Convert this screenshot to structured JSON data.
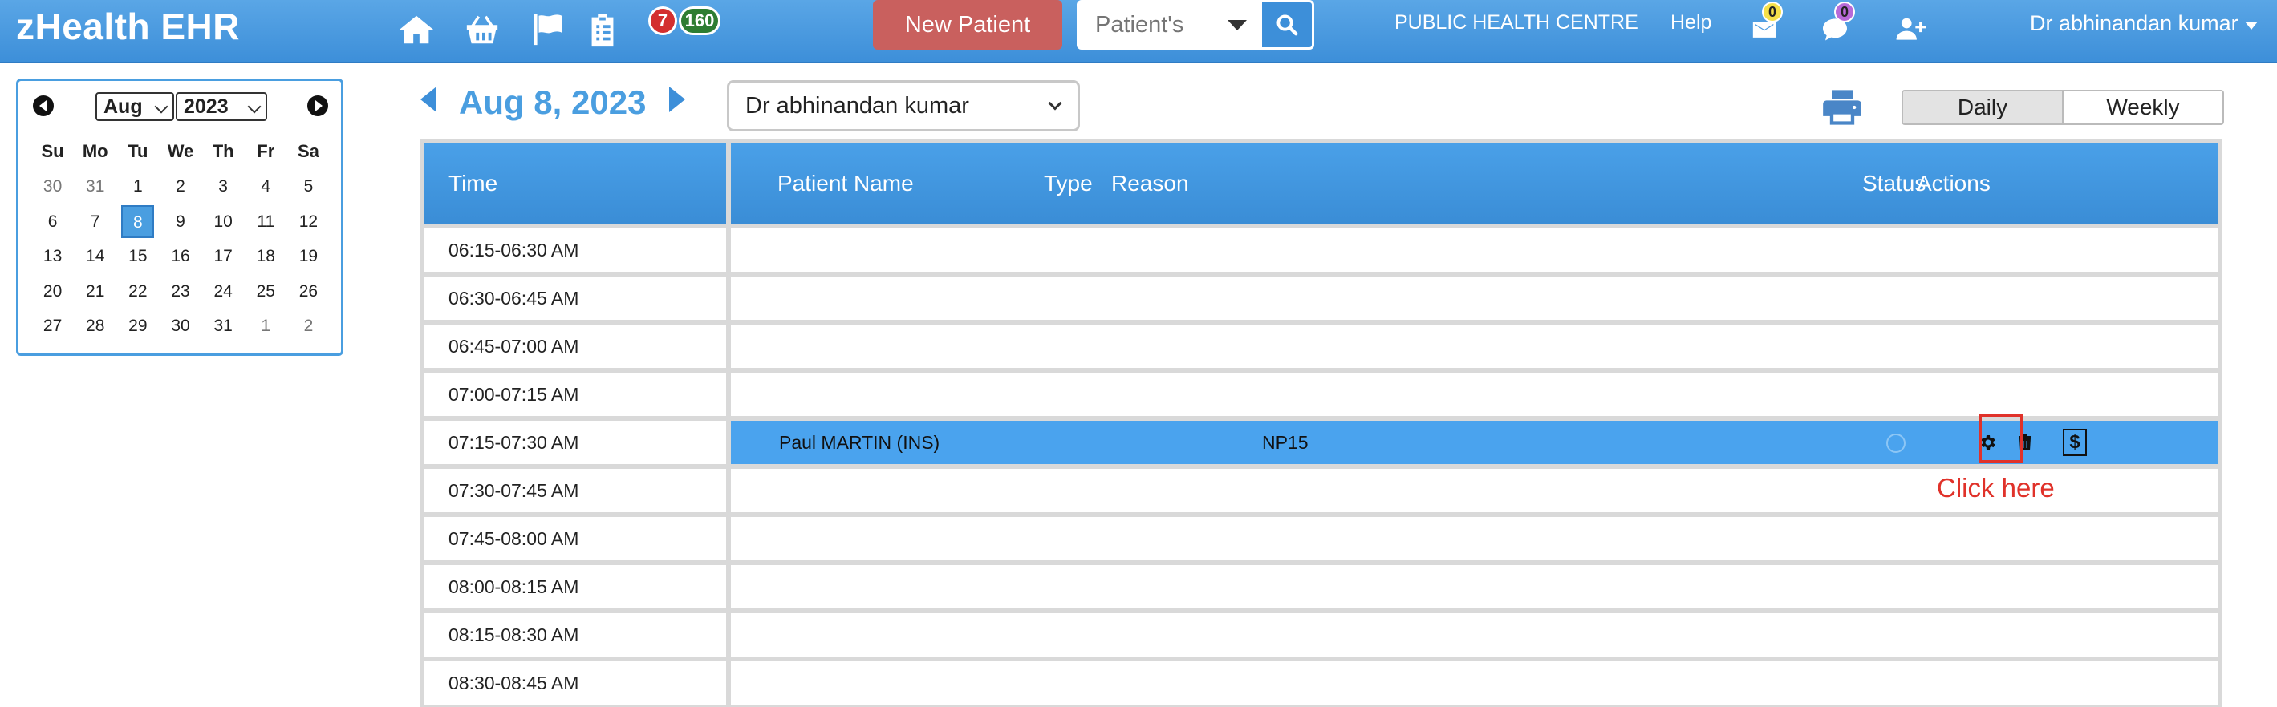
{
  "app": {
    "brand": "zHealth EHR",
    "badges": {
      "red": "7",
      "green": "160"
    },
    "new_patient_label": "New Patient",
    "search_placeholder": "Patient's",
    "facility": "PUBLIC HEALTH CENTRE",
    "help": "Help",
    "mail_count": "0",
    "chat_count": "0",
    "user": "Dr abhinandan kumar",
    "colors": {
      "topbar": "#3d8fd9",
      "new_patient": "#c9605e",
      "accent": "#4a9ee0",
      "annotation": "#e0322a"
    },
    "icons": [
      "home-icon",
      "basket-icon",
      "flag-icon",
      "clipboard-icon",
      "search-icon",
      "envelope-icon",
      "chat-icon",
      "add-user-icon"
    ]
  },
  "calendar": {
    "month": "Aug",
    "year": "2023",
    "weekdays": [
      "Su",
      "Mo",
      "Tu",
      "We",
      "Th",
      "Fr",
      "Sa"
    ],
    "weeks": [
      [
        {
          "d": "30",
          "o": true
        },
        {
          "d": "31",
          "o": true
        },
        {
          "d": "1"
        },
        {
          "d": "2"
        },
        {
          "d": "3"
        },
        {
          "d": "4"
        },
        {
          "d": "5"
        }
      ],
      [
        {
          "d": "6"
        },
        {
          "d": "7"
        },
        {
          "d": "8",
          "s": true
        },
        {
          "d": "9"
        },
        {
          "d": "10"
        },
        {
          "d": "11"
        },
        {
          "d": "12"
        }
      ],
      [
        {
          "d": "13"
        },
        {
          "d": "14"
        },
        {
          "d": "15"
        },
        {
          "d": "16"
        },
        {
          "d": "17"
        },
        {
          "d": "18"
        },
        {
          "d": "19"
        }
      ],
      [
        {
          "d": "20"
        },
        {
          "d": "21"
        },
        {
          "d": "22"
        },
        {
          "d": "23"
        },
        {
          "d": "24"
        },
        {
          "d": "25"
        },
        {
          "d": "26"
        }
      ],
      [
        {
          "d": "27"
        },
        {
          "d": "28"
        },
        {
          "d": "29"
        },
        {
          "d": "30"
        },
        {
          "d": "31"
        },
        {
          "d": "1",
          "o": true
        },
        {
          "d": "2",
          "o": true
        }
      ]
    ]
  },
  "schedule": {
    "date": "Aug 8, 2023",
    "provider": "Dr abhinandan kumar",
    "views": [
      "Daily",
      "Weekly"
    ],
    "active_view": "Daily",
    "headers": {
      "time": "Time",
      "patient": "Patient Name",
      "type": "Type",
      "reason": "Reason",
      "status": "Status",
      "actions": "Actions"
    },
    "rows": [
      {
        "time": "06:15-06:30 AM"
      },
      {
        "time": "06:30-06:45 AM"
      },
      {
        "time": "06:45-07:00 AM"
      },
      {
        "time": "07:00-07:15 AM"
      },
      {
        "time": "07:15-07:30 AM",
        "patient": "Paul MARTIN (INS)",
        "type": "NP15",
        "booked": true
      },
      {
        "time": "07:30-07:45 AM"
      },
      {
        "time": "07:45-08:00 AM"
      },
      {
        "time": "08:00-08:15 AM"
      },
      {
        "time": "08:15-08:30 AM"
      },
      {
        "time": "08:30-08:45 AM"
      }
    ],
    "dollar_label": "$"
  },
  "annotation": {
    "label": "Click here"
  }
}
